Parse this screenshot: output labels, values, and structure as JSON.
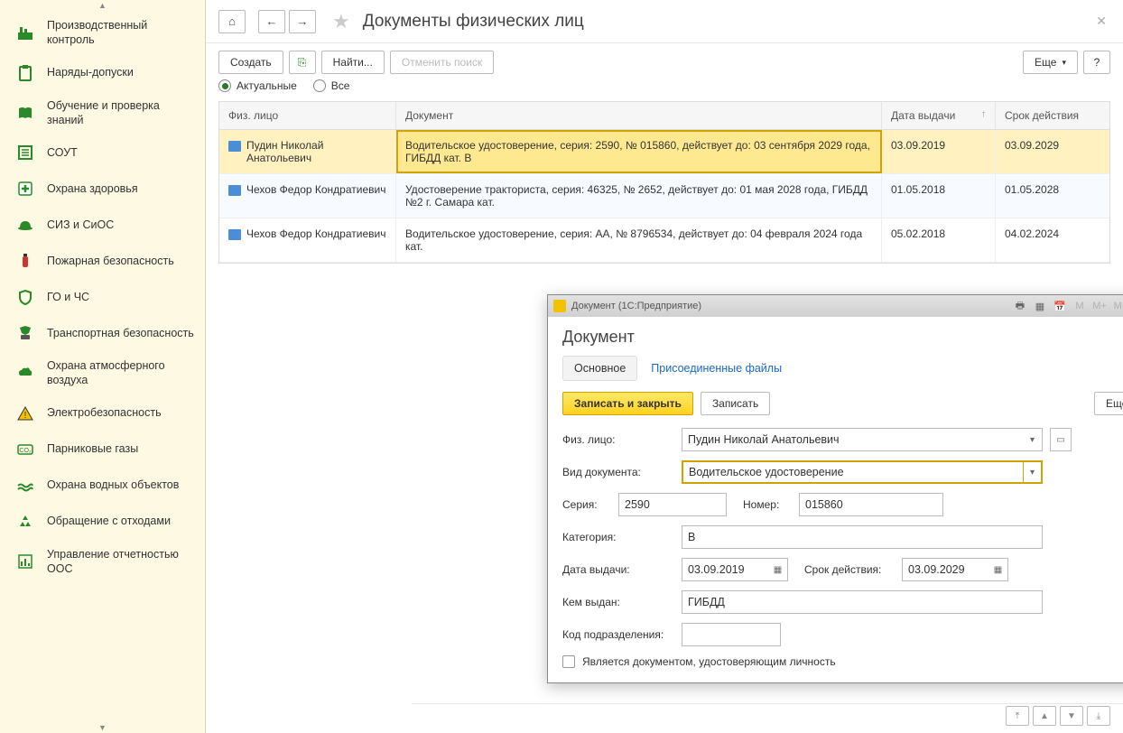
{
  "sidebar": {
    "items": [
      {
        "label": "Производственный контроль"
      },
      {
        "label": "Наряды-допуски"
      },
      {
        "label": "Обучение и проверка знаний"
      },
      {
        "label": "СОУТ"
      },
      {
        "label": "Охрана здоровья"
      },
      {
        "label": "СИЗ и СиОС"
      },
      {
        "label": "Пожарная безопасность"
      },
      {
        "label": "ГО и ЧС"
      },
      {
        "label": "Транспортная безопасность"
      },
      {
        "label": "Охрана атмосферного воздуха"
      },
      {
        "label": "Электробезопасность"
      },
      {
        "label": "Парниковые газы"
      },
      {
        "label": "Охрана водных объектов"
      },
      {
        "label": "Обращение с отходами"
      },
      {
        "label": "Управление отчетностью ООС"
      }
    ]
  },
  "header": {
    "title": "Документы физических лиц"
  },
  "toolbar": {
    "create": "Создать",
    "find": "Найти...",
    "cancel_search": "Отменить поиск",
    "more": "Еще"
  },
  "filters": {
    "actual": "Актуальные",
    "all": "Все"
  },
  "table": {
    "columns": {
      "person": "Физ. лицо",
      "document": "Документ",
      "issue_date": "Дата выдачи",
      "expiry": "Срок действия"
    },
    "rows": [
      {
        "person": "Пудин Николай Анатольевич",
        "document": "Водительское удостоверение, серия: 2590, № 015860, действует до: 03 сентября 2029 года, ГИБДД кат. B",
        "issue_date": "03.09.2019",
        "expiry": "03.09.2029",
        "selected": true
      },
      {
        "person": "Чехов Федор Кондратиевич",
        "document": "Удостоверение тракториста, серия: 46325, № 2652, действует до: 01 мая 2028 года, ГИБДД №2 г. Самара кат.",
        "issue_date": "01.05.2018",
        "expiry": "01.05.2028"
      },
      {
        "person": "Чехов Федор Кондратиевич",
        "document": "Водительское удостоверение, серия: АА, № 8796534, действует до: 04 февраля 2024 года кат.",
        "issue_date": "05.02.2018",
        "expiry": "04.02.2024"
      }
    ]
  },
  "dialog": {
    "window_title": "Документ  (1С:Предприятие)",
    "heading": "Документ",
    "tabs": {
      "main": "Основное",
      "files": "Присоединенные файлы"
    },
    "buttons": {
      "save_close": "Записать и закрыть",
      "save": "Записать",
      "more": "Еще"
    },
    "fields": {
      "person_label": "Физ. лицо:",
      "person_value": "Пудин Николай Анатольевич",
      "doc_type_label": "Вид документа:",
      "doc_type_value": "Водительское удостоверение",
      "series_label": "Серия:",
      "series_value": "2590",
      "number_label": "Номер:",
      "number_value": "015860",
      "category_label": "Категория:",
      "category_value": "B",
      "issue_date_label": "Дата выдачи:",
      "issue_date_value": "03.09.2019",
      "expiry_label": "Срок действия:",
      "expiry_value": "03.09.2029",
      "issued_by_label": "Кем выдан:",
      "issued_by_value": "ГИБДД",
      "dept_code_label": "Код подразделения:",
      "dept_code_value": "",
      "identity_doc_label": "Является документом, удостоверяющим личность"
    }
  }
}
